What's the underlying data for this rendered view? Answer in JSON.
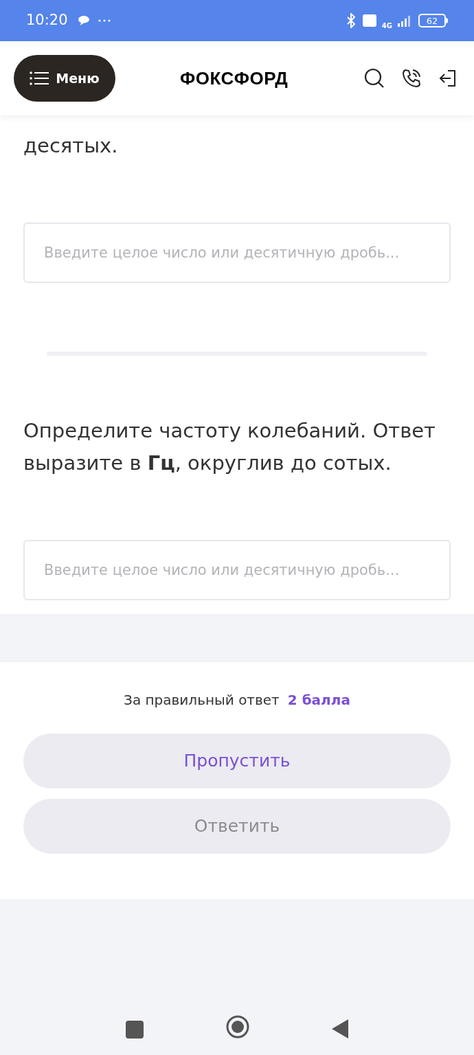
{
  "status_bar": {
    "time": "10:20",
    "battery": "62",
    "network": "4G"
  },
  "header": {
    "menu_button": "Меню",
    "logo": "ФОКСФОРД"
  },
  "questions": [
    {
      "text_lines": [
        "десятых."
      ],
      "answer": {
        "placeholder": "Введите целое число или десятичную дробь..."
      }
    },
    {
      "text_lines": [
        "Определите частоту колебаний. Ответ",
        "выразите в **Гц**, округлив до сотых."
      ],
      "answer": {
        "placeholder": "Введите целое число или десятичную дробь..."
      }
    }
  ],
  "footer": {
    "score_label": "За правильный ответ",
    "score_value": "2 балла",
    "buttons": [
      {
        "label": "Пропустить",
        "disabled": false
      },
      {
        "label": "Ответить",
        "disabled": true
      }
    ]
  }
}
